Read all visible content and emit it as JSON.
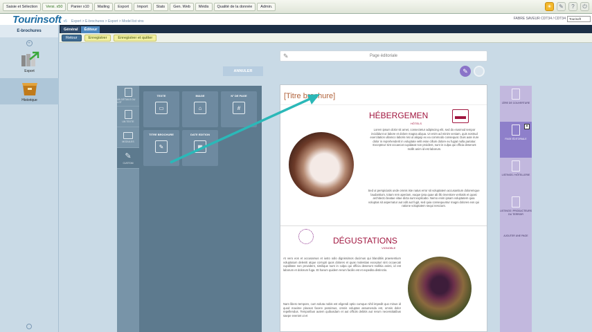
{
  "menubar": {
    "items": [
      "Saisie et Sélection",
      "Versi. x50",
      "Panier x10",
      "Mailing",
      "Export",
      "Import",
      "Stats",
      "Gen. Web",
      "Médis",
      "Qualité de la donnée",
      "Admin."
    ]
  },
  "header": {
    "logo": "Tourinsoft",
    "version": "v5",
    "breadcrumb": "Export > E-brochures > Export > Model list vins",
    "user": "FABRE SAVEUR CDT34 / CDT34",
    "user_select": "Tourisoft"
  },
  "sidebar": {
    "title": "E-brochures",
    "items": [
      {
        "label": "Export",
        "icon": "export-icon"
      },
      {
        "label": "Historique",
        "icon": "history-icon"
      }
    ]
  },
  "tabs": [
    "Général",
    "Éditeur"
  ],
  "actions": {
    "back": "Retour",
    "save": "Enregistrer",
    "save_quit": "Enregistrer et quitter"
  },
  "editor": {
    "editorial_label": "Page éditoriale",
    "annuler": "ANNULER"
  },
  "tools_column": [
    {
      "label": "un détails du lot"
    },
    {
      "label": "un texte"
    },
    {
      "label": "modules"
    },
    {
      "label": "custom"
    }
  ],
  "tools": [
    {
      "label": "TEXTE",
      "glyph": "▭"
    },
    {
      "label": "IMAGE",
      "glyph": "⌂"
    },
    {
      "label": "N° DE PAGE",
      "glyph": "#"
    },
    {
      "label": "TITRE BROCHURE",
      "glyph": "✎"
    },
    {
      "label": "DATE EDITION",
      "glyph": "▦"
    }
  ],
  "page": {
    "title": "[Titre brochure]",
    "heb_title": "HÉBERGEMEN",
    "heb_sub": "HÔTELS",
    "heb_text_1": "Lorem ipsum dolor sit amet, consectetur adipiscing elit, sed do eiusmod tempor incididunt ut labore et dolore magna aliqua. Ut enim ad minim veniam, quis nostrud exercitation ullamco laboris nisi ut aliquip ex ea commodo consequat. Duis aute irure dolor in reprehenderit in voluptate velit esse cillum dolore eu fugiat nulla pariatur. Excepteur sint occaecat cupidatat non proident, sunt in culpa qui officia deserunt mollit anim id est laborum.",
    "heb_text_2": "Sed ut perspiciatis unde omnis iste natus error sit voluptatem accusantium doloremque laudantium, totam rem aperiam, eaque ipsa quae ab illo inventore veritatis et quasi architecto beatae vitae dicta sunt explicabo. Nemo enim ipsam voluptatem quia voluptas sit aspernatur aut odit aut fugit, sed quia consequuntur magni dolores eos qui ratione voluptatem sequi nesciunt.",
    "deg_title": "DÉGUSTATIONS",
    "deg_sub": "VIGNOBLE",
    "deg_text_1": "At vero eos et accusamus et iusto odio dignissimos ducimus qui blanditiis praesentium voluptatum deleniti atque corrupti quos dolores et quas molestias excepturi sint occaecati cupiditate non provident, similique sunt in culpa qui officia deserunt mollitia animi, id est laborum et dolorum fuga. Et harum quidem rerum facilis est et expedita distinctio.",
    "deg_text_2": "Nam libero tempore, cum soluta nobis est eligendi optio cumque nihil impedit quo minus id quod maxime placeat facere possimus, omnis voluptas assumenda est, omnis dolor repellendus. Temporibus autem quibusdam et aut officiis debitis aut rerum necessitatibus saepe eveniet ut et"
  },
  "page_panel": [
    {
      "label": "1ÈRE DE COUVERTURE"
    },
    {
      "label": "PAGE ÉDITORIALE",
      "active": true
    },
    {
      "label": "LISTINGS / HÔTELLERIE"
    },
    {
      "label": "LISTINGS / PRODUCTEURS DU TERROIR"
    },
    {
      "label": "AJOUTER UNE PAGE"
    }
  ]
}
